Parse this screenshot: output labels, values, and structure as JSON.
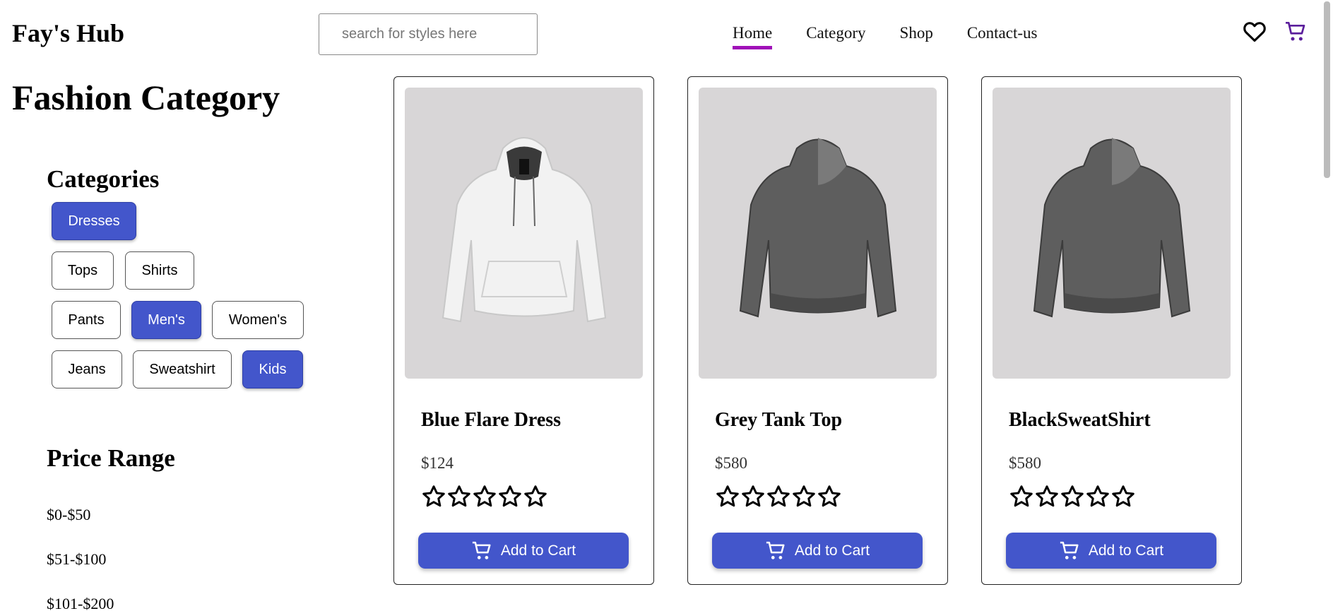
{
  "header": {
    "brand": "Fay's Hub",
    "search_placeholder": "search for styles here",
    "nav": [
      {
        "label": "Home",
        "active": true
      },
      {
        "label": "Category",
        "active": false
      },
      {
        "label": "Shop",
        "active": false
      },
      {
        "label": "Contact-us",
        "active": false
      }
    ],
    "icons": [
      "heart-icon",
      "cart-icon"
    ],
    "accent_color": "#a010b8",
    "cart_icon_color": "#5b1e9c"
  },
  "sidebar": {
    "page_title": "Fashion Category",
    "categories_title": "Categories",
    "categories": [
      {
        "label": "Dresses",
        "selected": true
      },
      {
        "label": "Tops",
        "selected": false
      },
      {
        "label": "Shirts",
        "selected": false
      },
      {
        "label": "Pants",
        "selected": false
      },
      {
        "label": "Men's",
        "selected": true
      },
      {
        "label": "Women's",
        "selected": false
      },
      {
        "label": "Jeans",
        "selected": false
      },
      {
        "label": "Sweatshirt",
        "selected": false
      },
      {
        "label": "Kids",
        "selected": true
      }
    ],
    "price_title": "Price Range",
    "price_ranges": [
      "$0-$50",
      "$51-$100",
      "$101-$200"
    ]
  },
  "products": [
    {
      "name": "Blue Flare Dress",
      "price": "$124",
      "rating": 0,
      "max_rating": 5,
      "button": "Add to Cart",
      "image": "white-hoodie-front"
    },
    {
      "name": "Grey Tank Top",
      "price": "$580",
      "rating": 0,
      "max_rating": 5,
      "button": "Add to Cart",
      "image": "grey-hoodie-back"
    },
    {
      "name": "BlackSweatShirt",
      "price": "$580",
      "rating": 0,
      "max_rating": 5,
      "button": "Add to Cart",
      "image": "grey-hoodie-back"
    }
  ],
  "colors": {
    "primary_button": "#4356cb",
    "image_bg": "#d8d6d7"
  }
}
